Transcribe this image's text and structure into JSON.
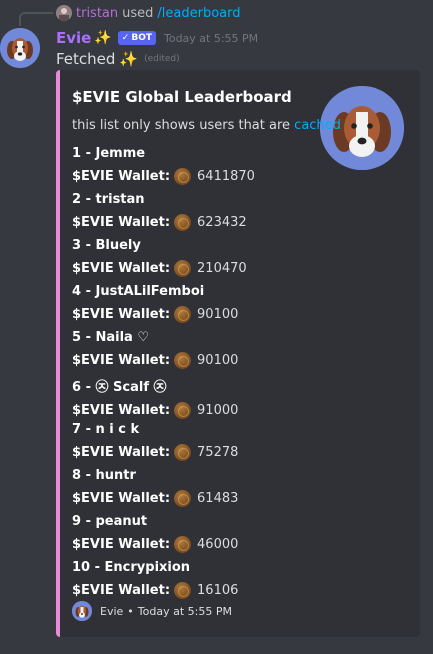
{
  "reply": {
    "username": "tristan",
    "used_text": "used",
    "command": "/leaderboard"
  },
  "message": {
    "username": "Evie",
    "sparkle": "✨",
    "bot_tag": "BOT",
    "bot_check": "✓",
    "timestamp": "Today at 5:55 PM",
    "content": "Fetched",
    "content_emoji": "✨",
    "edited": "(edited)"
  },
  "embed": {
    "accent_color": "#e68bd7",
    "title": "$EVIE Global Leaderboard",
    "description_prefix": "this list only shows users that are ",
    "description_link": "cached",
    "wallet_label": "$EVIE Wallet:",
    "entries": [
      {
        "rank": "1 - Jemme",
        "wallet": "6411870"
      },
      {
        "rank": "2 - tristan",
        "wallet": "623432"
      },
      {
        "rank": "3 - Bluely",
        "wallet": "210470"
      },
      {
        "rank": "4 - JustALilFemboi",
        "wallet": "90100"
      },
      {
        "rank": "5 - Naila ♡",
        "wallet": "90100"
      },
      {
        "rank": "6 - ㉨ Scalf ㉨",
        "wallet": "91000"
      },
      {
        "rank": "7 - n i c k",
        "wallet": "75278"
      },
      {
        "rank": "8 - huntr",
        "wallet": "61483"
      },
      {
        "rank": "9 - peanut",
        "wallet": "46000"
      },
      {
        "rank": "10 - Encrypixion",
        "wallet": "16106"
      }
    ],
    "footer_name": "Evie",
    "footer_sep": "•",
    "footer_time": "Today at 5:55 PM"
  }
}
